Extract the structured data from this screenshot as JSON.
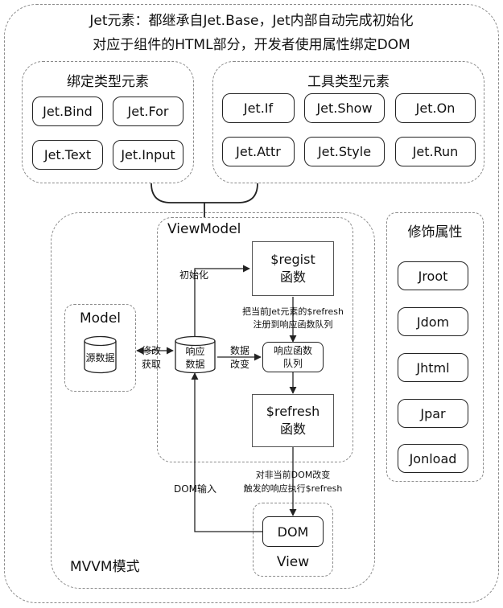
{
  "header": {
    "line1": "Jet元素：都继承自Jet.Base，Jet内部自动完成初始化",
    "line2": "对应于组件的HTML部分，开发者使用属性绑定DOM"
  },
  "binding_group": {
    "title": "绑定类型元素",
    "items": [
      "Jet.Bind",
      "Jet.For",
      "Jet.Text",
      "Jet.Input"
    ]
  },
  "tool_group": {
    "title": "工具类型元素",
    "items": [
      "Jet.If",
      "Jet.Show",
      "Jet.On",
      "Jet.Attr",
      "Jet.Style",
      "Jet.Run"
    ]
  },
  "decorator_group": {
    "title": "修饰属性",
    "items": [
      "Jroot",
      "Jdom",
      "Jhtml",
      "Jpar",
      "Jonload"
    ]
  },
  "mvvm": {
    "label": "MVVM模式",
    "viewmodel_label": "ViewModel",
    "model_label": "Model",
    "view_label": "View",
    "source_data": "源数据",
    "modify_get": [
      "修改",
      "获取"
    ],
    "reactive_data": [
      "响应",
      "数据"
    ],
    "init_label": "初始化",
    "data_change": [
      "数据",
      "改变"
    ],
    "regist": [
      "$regist",
      "函数"
    ],
    "register_note": [
      "把当前Jet元素的$refresh",
      "注册到响应函数队列"
    ],
    "queue": [
      "响应函数",
      "队列"
    ],
    "refresh": [
      "$refresh",
      "函数"
    ],
    "execute_note": [
      "对非当前DOM改变",
      "触发的响应执行$refresh"
    ],
    "dom": "DOM",
    "dom_input": "DOM输入"
  }
}
